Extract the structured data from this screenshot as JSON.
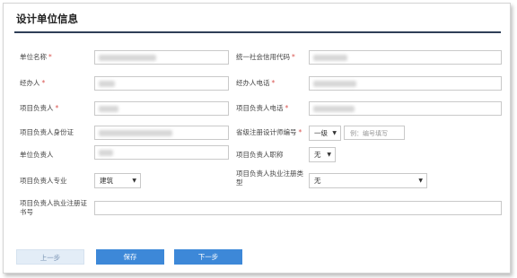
{
  "title": "设计单位信息",
  "labels": {
    "unit_name": "单位名称",
    "credit_code": "统一社会信用代码",
    "contact": "经办人",
    "contact_phone": "经办人电话",
    "project_leader": "项目负责人",
    "leader_phone": "项目负责人电话",
    "leader_id": "项目负责人身份证",
    "reg_cert": "省级注册设计师编号",
    "unit_leader": "单位负责人",
    "leader_title": "项目负责人职称",
    "leader_major": "项目负责人专业",
    "leader_qualification": "项目负责人执业注册类型",
    "practice_cert": "项目负责人执业注册证书号"
  },
  "values": {
    "reg_cert_type": "一级",
    "reg_cert_placeholder": "例：编号填写",
    "leader_title": "无",
    "leader_major": "建筑",
    "leader_qualification": "无"
  },
  "buttons": {
    "prev": "上一步",
    "save": "保存",
    "next": "下一步"
  }
}
